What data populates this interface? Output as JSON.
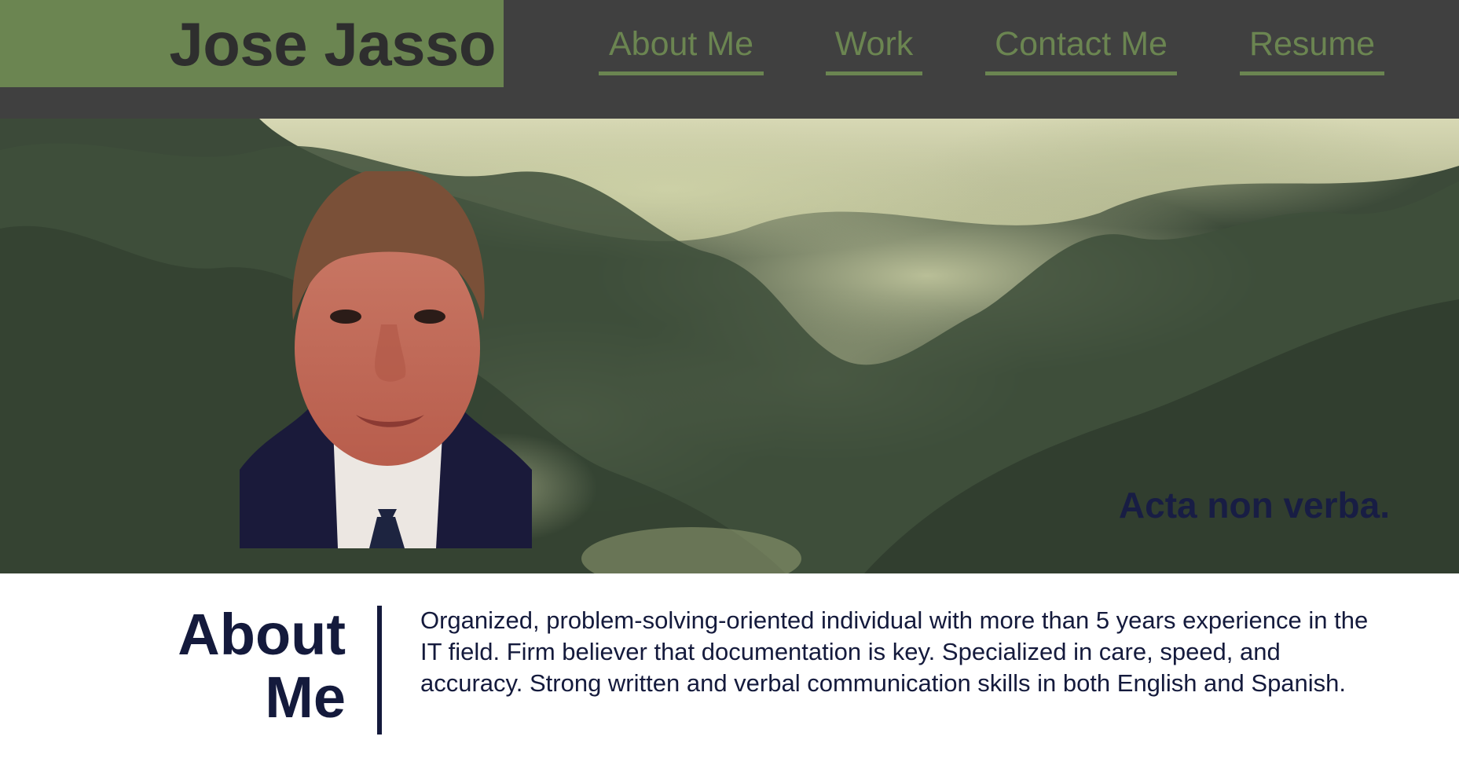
{
  "site": {
    "name": "Jose Jasso"
  },
  "nav": {
    "items": [
      {
        "label": "About Me"
      },
      {
        "label": "Work"
      },
      {
        "label": "Contact Me"
      },
      {
        "label": "Resume"
      }
    ]
  },
  "hero": {
    "tagline": "Acta non verba.",
    "background_image": "misty-forest-hills",
    "portrait_image": "profile-photo"
  },
  "about": {
    "title_line1": "About",
    "title_line2": "Me",
    "body": "Organized, problem-solving-oriented individual with more than 5 years experience in the IT field. Firm believer that documentation is key. Specialized in care, speed, and accuracy. Strong written and verbal communication skills in both English and Spanish."
  },
  "colors": {
    "header_bg": "#404040",
    "brand_bg": "#6b8551",
    "brand_text": "#2e2e2e",
    "nav_accent": "#6b8551",
    "navy_text": "#141a3c",
    "page_bg": "#ffffff"
  }
}
